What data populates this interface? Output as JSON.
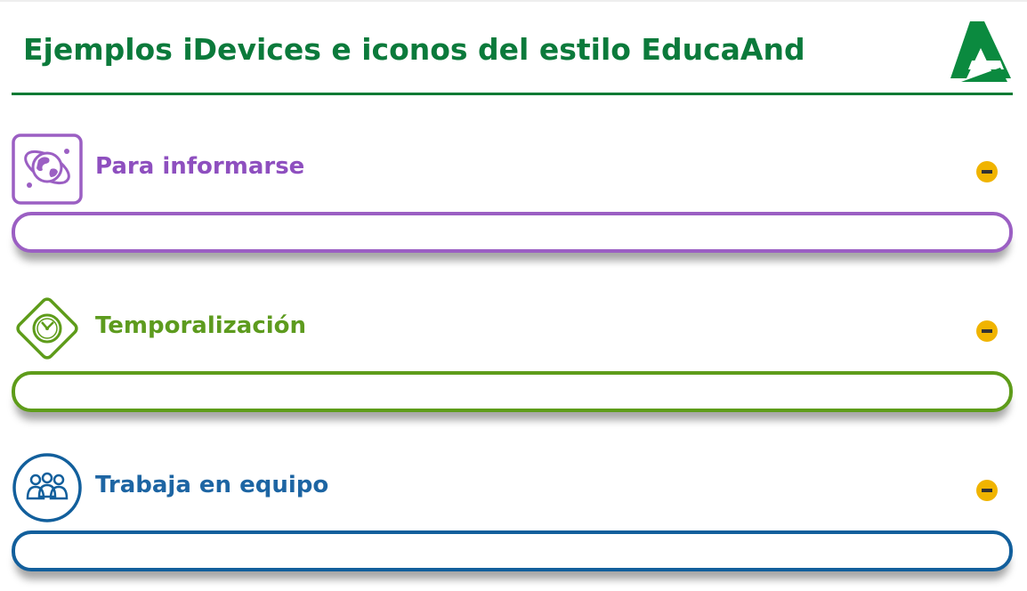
{
  "header": {
    "title": "Ejemplos iDevices e iconos del estilo EducaAnd",
    "logo_icon": "junta-andalucia-logo"
  },
  "colors": {
    "brand_green": "#0b7a3b",
    "toggle": "#f0b400",
    "informarse": "#9b5fc3",
    "temporalizacion": "#5e9c1a",
    "equipo": "#125f9c"
  },
  "idevices": [
    {
      "title": "Para informarse",
      "icon": "globe-icon",
      "toggle_icon": "collapse-minus-icon"
    },
    {
      "title": "Temporalización",
      "icon": "clock-icon",
      "toggle_icon": "collapse-minus-icon"
    },
    {
      "title": "Trabaja en equipo",
      "icon": "team-icon",
      "toggle_icon": "collapse-minus-icon"
    }
  ]
}
